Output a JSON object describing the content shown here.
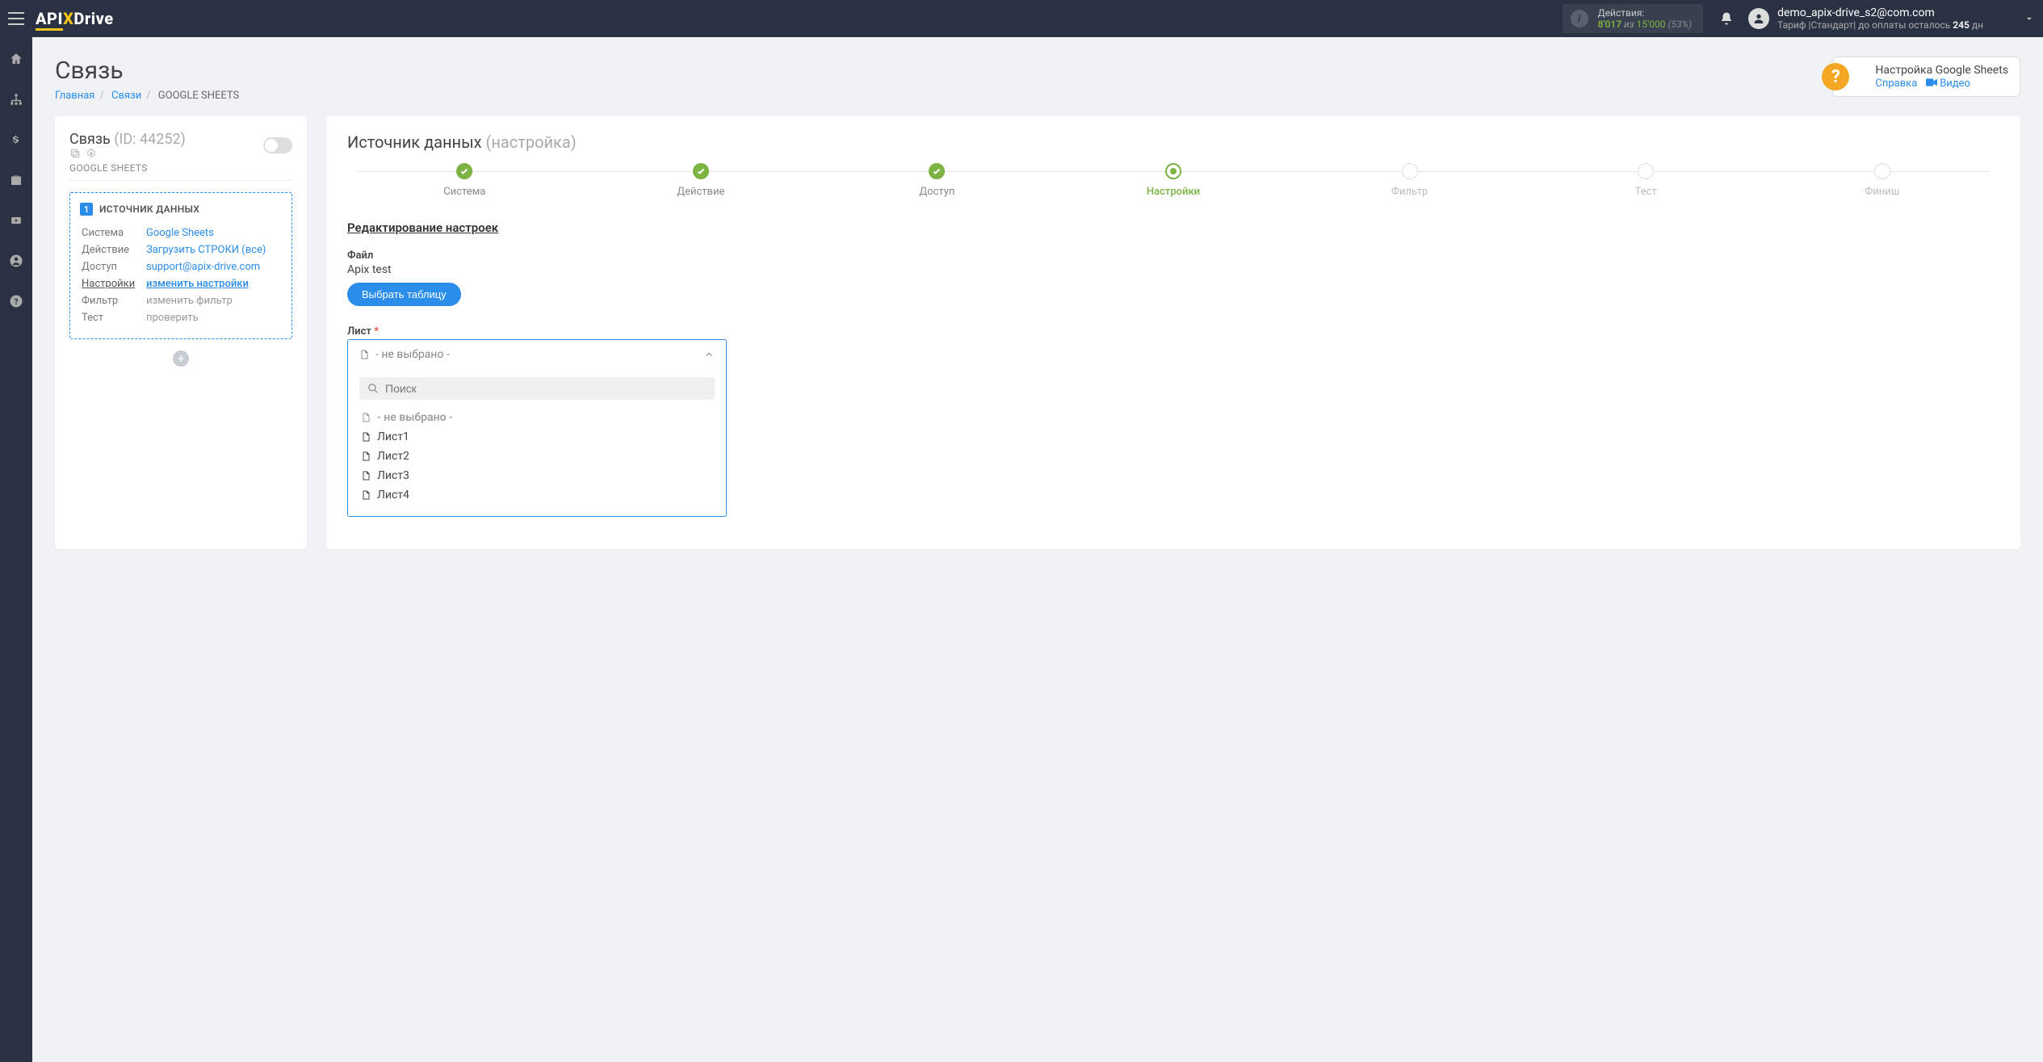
{
  "topbar": {
    "actions_label": "Действия:",
    "actions_used": "8'017",
    "actions_sep": "из",
    "actions_total": "15'000",
    "actions_pct": "(53%)",
    "email": "demo_apix-drive_s2@com.com",
    "tariff_prefix": "Тариф |Стандарт| до оплаты осталось",
    "tariff_days": "245",
    "tariff_suffix": "дн"
  },
  "page": {
    "title": "Связь",
    "bc_home": "Главная",
    "bc_links": "Связи",
    "bc_current": "GOOGLE SHEETS"
  },
  "help": {
    "title": "Настройка Google Sheets",
    "link1": "Справка",
    "link2": "Видео"
  },
  "leftcard": {
    "title": "Связь",
    "id_label": "(ID: 44252)",
    "sub": "GOOGLE SHEETS",
    "badge": "1",
    "src_title": "ИСТОЧНИК ДАННЫХ",
    "rows": {
      "system_l": "Система",
      "system_v": "Google Sheets",
      "action_l": "Действие",
      "action_v": "Загрузить СТРОКИ (все)",
      "access_l": "Доступ",
      "access_v": "support@apix-drive.com",
      "settings_l": "Настройки",
      "settings_v": "изменить настройки",
      "filter_l": "Фильтр",
      "filter_v": "изменить фильтр",
      "test_l": "Тест",
      "test_v": "проверить"
    }
  },
  "rightcard": {
    "title_a": "Источник данных",
    "title_b": "(настройка)",
    "steps": [
      "Система",
      "Действие",
      "Доступ",
      "Настройки",
      "Фильтр",
      "Тест",
      "Финиш"
    ],
    "sec_title": "Редактирование настроек",
    "file_label": "Файл",
    "file_value": "Apix test",
    "btn_select": "Выбрать таблицу",
    "sheet_label": "Лист",
    "dd_placeholder": "- не выбрано -",
    "dd_search": "Поиск",
    "dd_options": [
      "- не выбрано -",
      "Лист1",
      "Лист2",
      "Лист3",
      "Лист4"
    ]
  }
}
